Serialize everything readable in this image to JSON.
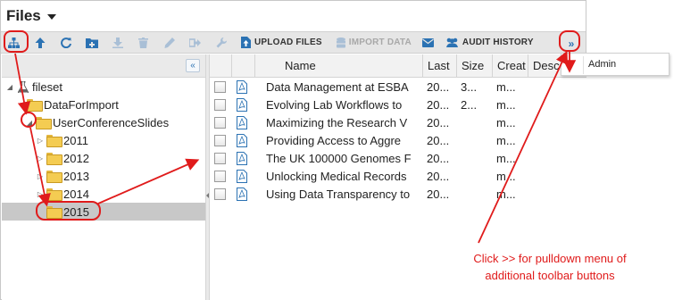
{
  "header": {
    "title": "Files"
  },
  "toolbar": {
    "icons": [
      "sitemap-icon",
      "arrow-up-icon",
      "refresh-icon",
      "new-folder-icon",
      "download-icon",
      "delete-icon",
      "edit-icon",
      "move-icon",
      "wrench-icon"
    ],
    "upload_label": "UPLOAD FILES",
    "import_label": "IMPORT DATA",
    "audit_label": "AUDIT HISTORY",
    "overflow_label": "»"
  },
  "menu": {
    "items": [
      {
        "label": "Admin"
      }
    ]
  },
  "tree": {
    "collapse_label": "«",
    "nodes": [
      {
        "label": "fileset",
        "icon": "flask-icon",
        "expanded": true
      },
      {
        "label": "DataForImport"
      },
      {
        "label": "UserConferenceSlides",
        "expanded": true
      },
      {
        "label": "2011"
      },
      {
        "label": "2012"
      },
      {
        "label": "2013"
      },
      {
        "label": "2014"
      },
      {
        "label": "2015",
        "selected": true
      }
    ]
  },
  "grid": {
    "columns": [
      "Name",
      "Last",
      "Size",
      "Creat",
      "Desc"
    ],
    "rows": [
      {
        "name": "Data Management at ESBA",
        "last": "20...",
        "size": "3...",
        "created": "m..."
      },
      {
        "name": "Evolving Lab Workflows to",
        "last": "20...",
        "size": "2...",
        "created": "m..."
      },
      {
        "name": "Maximizing the Research V",
        "last": "20...",
        "size": "",
        "created": "m..."
      },
      {
        "name": "Providing Access to Aggre",
        "last": "20...",
        "size": "",
        "created": "m..."
      },
      {
        "name": "The UK 100000 Genomes F",
        "last": "20...",
        "size": "",
        "created": "m..."
      },
      {
        "name": "Unlocking Medical Records",
        "last": "20...",
        "size": "",
        "created": "m..."
      },
      {
        "name": "Using Data Transparency to",
        "last": "20...",
        "size": "",
        "created": "m..."
      }
    ]
  },
  "annotation": {
    "line1": "Click >> for pulldown menu of",
    "line2": "additional toolbar buttons"
  },
  "colors": {
    "accent": "#2b72b3",
    "annotation": "#e01b1b",
    "selection": "#c8c8c8",
    "toolbar": "#e6e6e6"
  }
}
